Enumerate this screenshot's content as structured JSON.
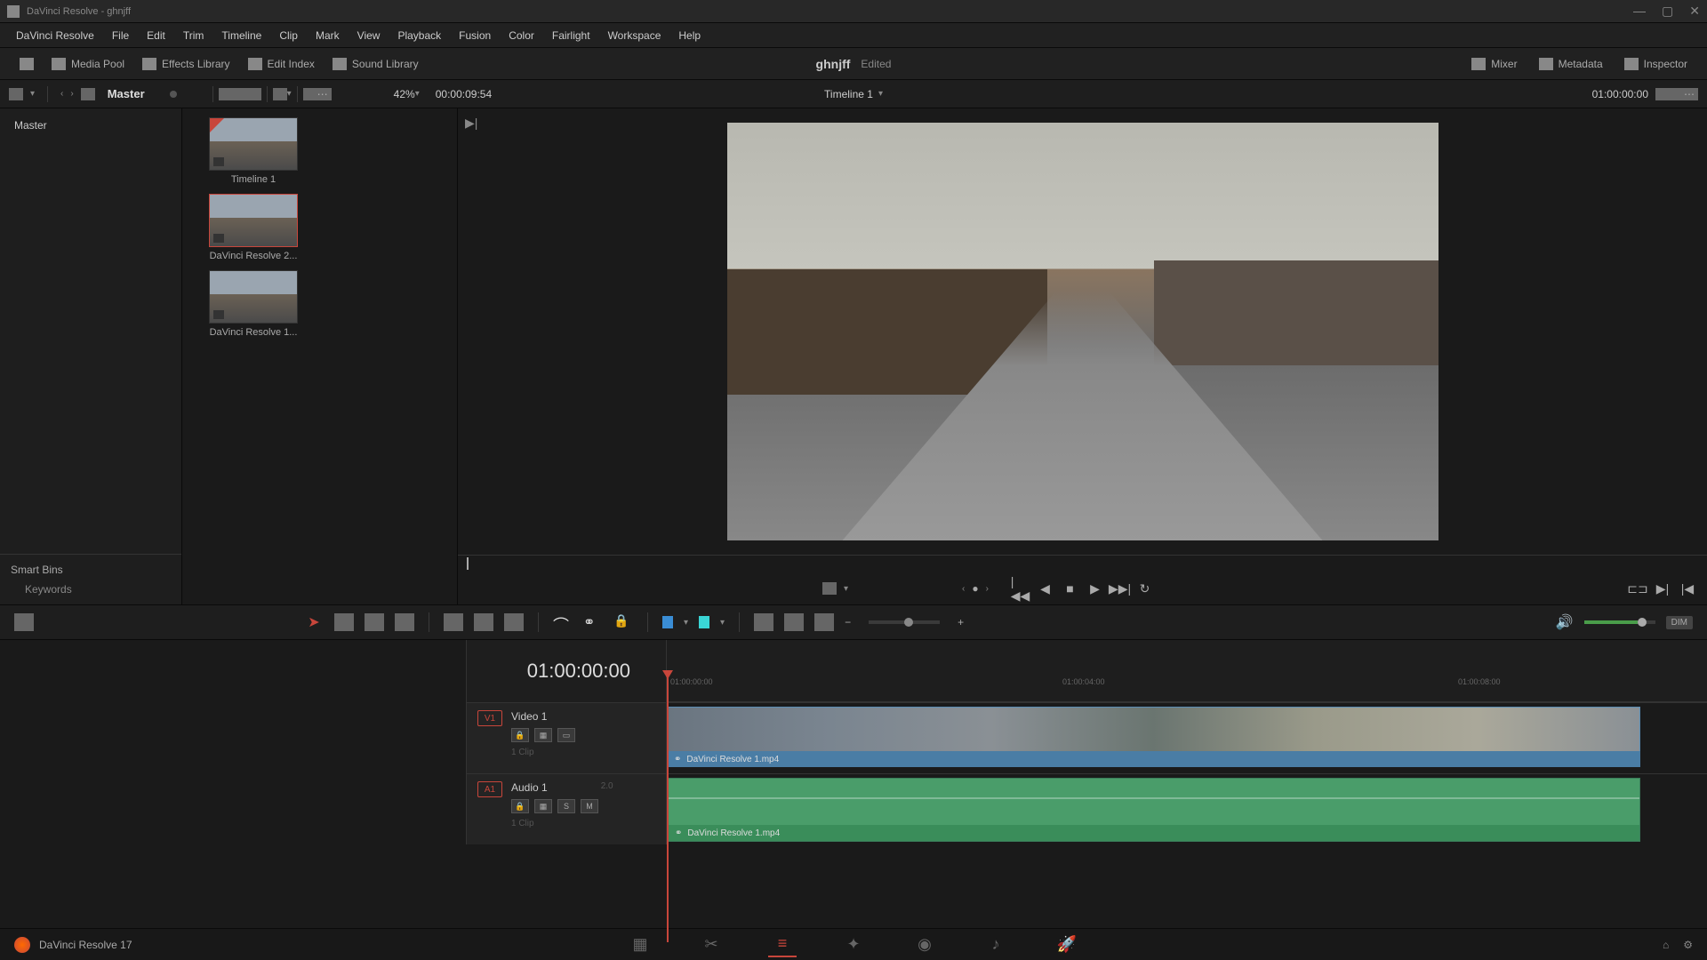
{
  "titlebar": {
    "app": "DaVinci Resolve",
    "project": "ghnjff"
  },
  "menu": [
    "DaVinci Resolve",
    "File",
    "Edit",
    "Trim",
    "Timeline",
    "Clip",
    "Mark",
    "View",
    "Playback",
    "Fusion",
    "Color",
    "Fairlight",
    "Workspace",
    "Help"
  ],
  "toolbar": {
    "media_pool": "Media Pool",
    "effects_library": "Effects Library",
    "edit_index": "Edit Index",
    "sound_library": "Sound Library",
    "mixer": "Mixer",
    "metadata": "Metadata",
    "inspector": "Inspector"
  },
  "project": {
    "name": "ghnjff",
    "status": "Edited"
  },
  "secondary": {
    "breadcrumb": "Master",
    "zoom": "42%",
    "source_tc": "00:00:09:54",
    "timeline_name": "Timeline 1",
    "record_tc": "01:00:00:00"
  },
  "bins": {
    "root": "Master",
    "smartbins_title": "Smart Bins",
    "keywords": "Keywords"
  },
  "clips": [
    {
      "label": "Timeline 1",
      "type": "timeline"
    },
    {
      "label": "DaVinci Resolve 2...",
      "type": "video",
      "selected": true
    },
    {
      "label": "DaVinci Resolve 1...",
      "type": "video"
    }
  ],
  "timeline": {
    "playhead_tc": "01:00:00:00",
    "ruler_marks": [
      "01:00:00:00",
      "01:00:04:00",
      "01:00:08:00"
    ],
    "video_track": {
      "tag": "V1",
      "name": "Video 1",
      "clips": "1 Clip"
    },
    "audio_track": {
      "tag": "A1",
      "name": "Audio 1",
      "level": "2.0",
      "clips": "1 Clip",
      "solo": "S",
      "mute": "M"
    },
    "clip_name": "DaVinci Resolve 1.mp4"
  },
  "footer": {
    "app_version": "DaVinci Resolve 17"
  },
  "volume": {
    "dim": "DIM"
  }
}
